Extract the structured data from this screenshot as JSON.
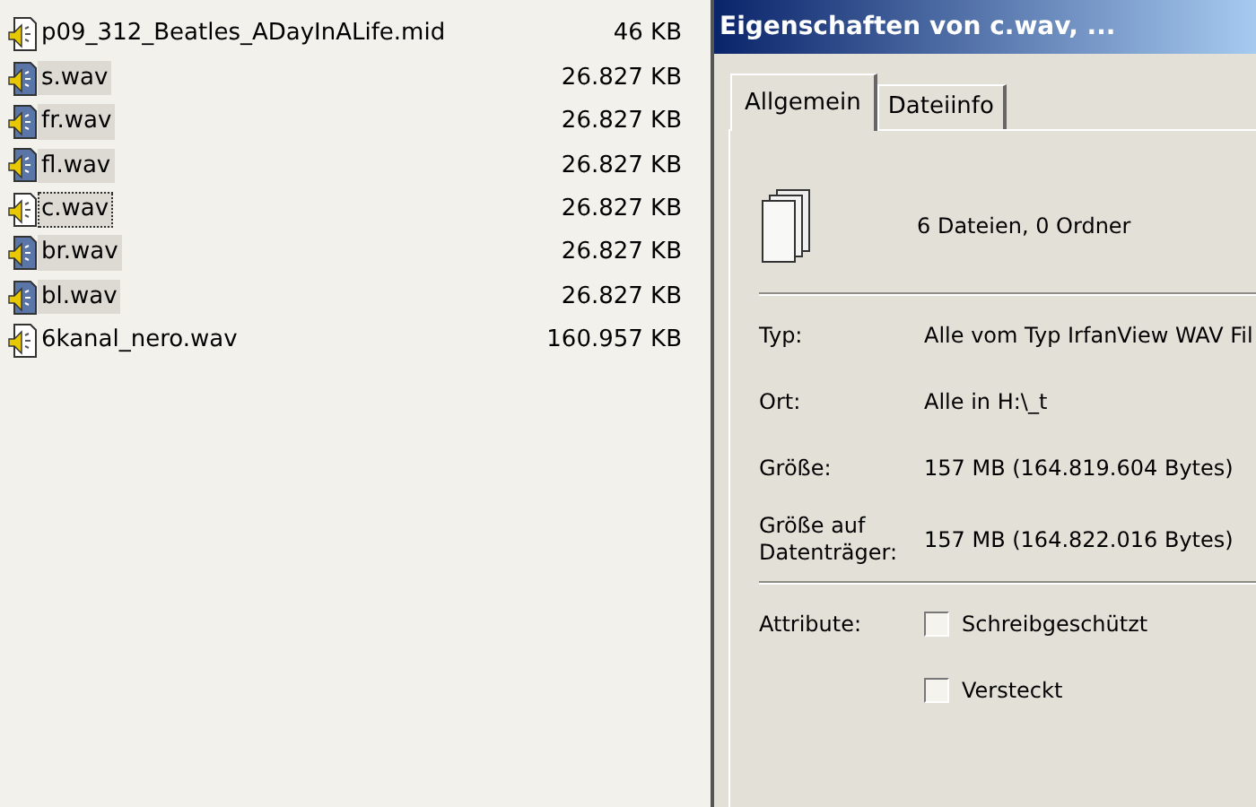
{
  "files": [
    {
      "name": "p09_312_Beatles_ADayInALife.mid",
      "size": "46 KB",
      "selected": false,
      "focused": false
    },
    {
      "name": "s.wav",
      "size": "26.827 KB",
      "selected": true,
      "focused": false
    },
    {
      "name": "fr.wav",
      "size": "26.827 KB",
      "selected": true,
      "focused": false
    },
    {
      "name": "fl.wav",
      "size": "26.827 KB",
      "selected": true,
      "focused": false
    },
    {
      "name": "c.wav",
      "size": "26.827 KB",
      "selected": true,
      "focused": true
    },
    {
      "name": "br.wav",
      "size": "26.827 KB",
      "selected": true,
      "focused": false
    },
    {
      "name": "bl.wav",
      "size": "26.827 KB",
      "selected": true,
      "focused": false
    },
    {
      "name": "6kanal_nero.wav",
      "size": "160.957 KB",
      "selected": false,
      "focused": false
    }
  ],
  "dialog": {
    "title": "Eigenschaften von c.wav, ...",
    "tabs": [
      {
        "label": "Allgemein",
        "selected": true
      },
      {
        "label": "Dateiinfo",
        "selected": false
      }
    ],
    "summary": "6 Dateien, 0 Ordner",
    "properties": [
      {
        "label": "Typ:",
        "value": "Alle vom Typ IrfanView WAV Fil"
      },
      {
        "label": "Ort:",
        "value": "Alle in H:\\_t"
      }
    ],
    "sizes": [
      {
        "label": "Größe:",
        "value": "157 MB (164.819.604 Bytes)"
      },
      {
        "label": "Größe auf Datenträger:",
        "value": "157 MB (164.822.016 Bytes)"
      }
    ],
    "attributes_label": "Attribute:",
    "attributes": [
      {
        "label": "Schreibgeschützt",
        "checked": false
      },
      {
        "label": "Versteckt",
        "checked": false
      }
    ]
  }
}
